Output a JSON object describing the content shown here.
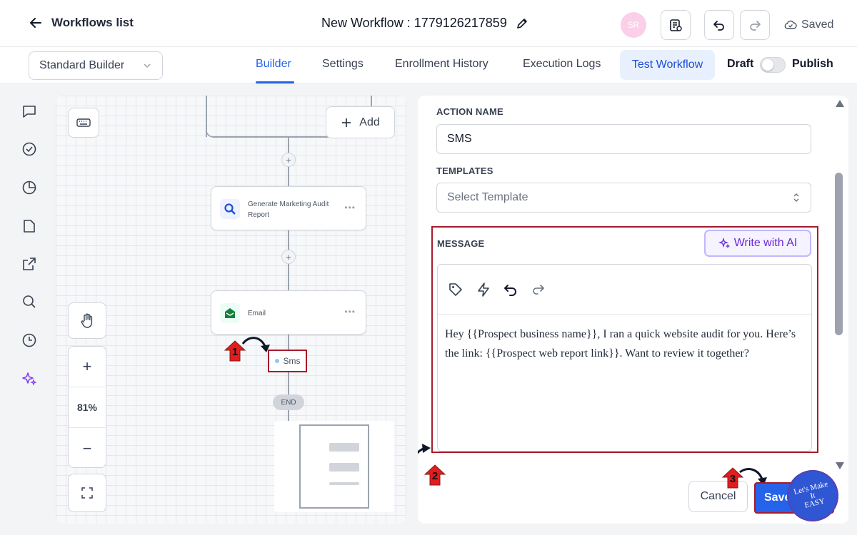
{
  "header": {
    "back_label": "Workflows list",
    "workflow_title": "New Workflow : 1779126217859",
    "avatar_initials": "SR",
    "saved_label": "Saved"
  },
  "tabs_row": {
    "builder_select": "Standard Builder",
    "tabs": [
      "Builder",
      "Settings",
      "Enrollment History",
      "Execution Logs"
    ],
    "test_workflow": "Test Workflow",
    "draft_label": "Draft",
    "publish_label": "Publish",
    "publish_on": false
  },
  "canvas": {
    "add_label": "Add",
    "zoom_level": "81%",
    "nodes": [
      {
        "label": "Generate Marketing Audit Report",
        "icon": "search-icon"
      },
      {
        "label": "Email",
        "icon": "mail-open-icon"
      }
    ],
    "sms_node": "Sms",
    "end_label": "END"
  },
  "panel": {
    "action_name_label": "ACTION NAME",
    "action_name_value": "SMS",
    "templates_label": "TEMPLATES",
    "templates_placeholder": "Select Template",
    "message_label": "MESSAGE",
    "write_ai_label": "Write with AI",
    "message_body": "Hey {{Prospect business name}}, I ran a quick website audit for you. Here’s the link: {{Prospect web report link}}. Want to review it together?",
    "cancel_label": "Cancel",
    "save_label": "Save"
  },
  "annotations": {
    "step1": "1",
    "step2": "2",
    "step3": "3",
    "badge_text": "Let's Make It EASY"
  },
  "colors": {
    "accent": "#2563eb",
    "highlight_border": "#a61b2b",
    "ai_purple": "#6d28d9",
    "email_green": "#15803d"
  }
}
